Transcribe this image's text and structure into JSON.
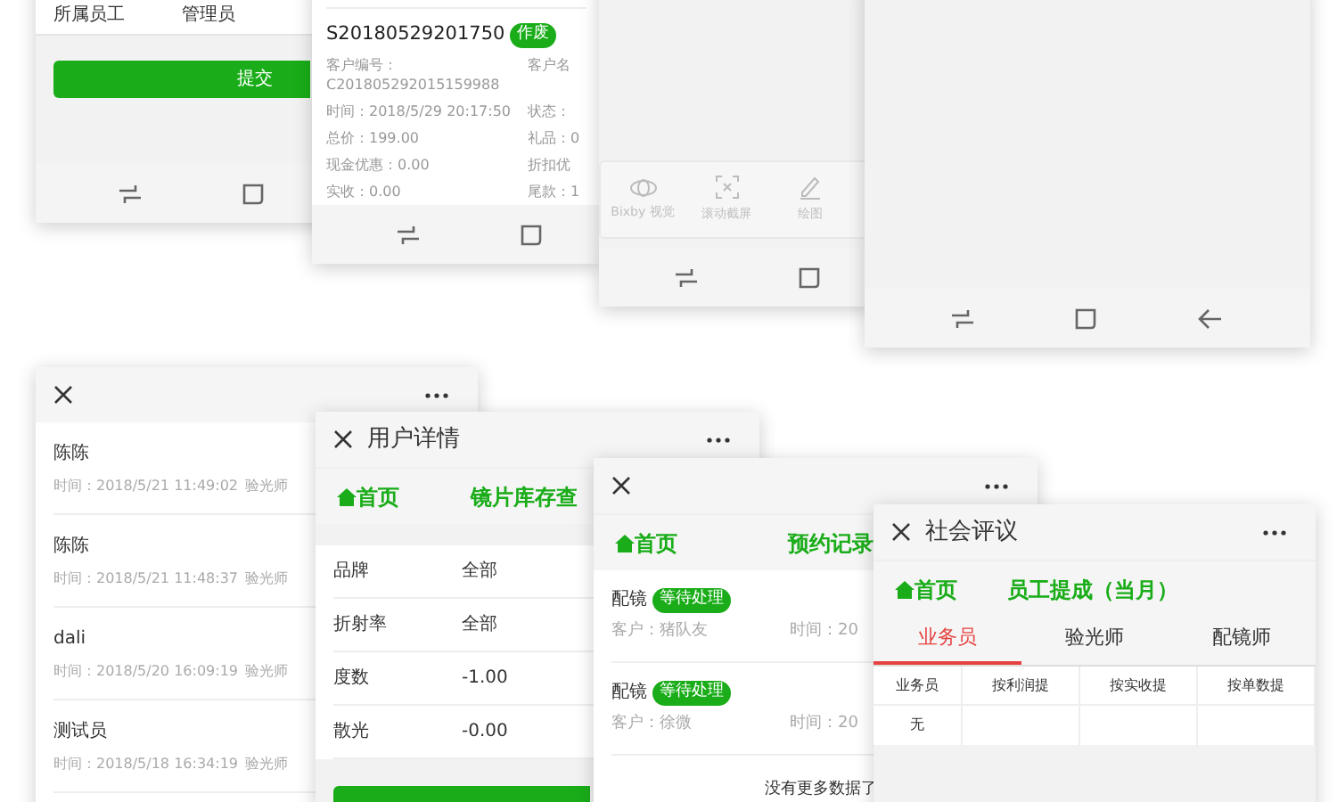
{
  "screens": [
    {
      "kind": "form",
      "rows": [
        {
          "label": "所属员工",
          "value": "管理员"
        }
      ],
      "button": "提交"
    },
    {
      "kind": "order",
      "order_no": "S20180529201750",
      "badge": "作废",
      "fields": [
        {
          "left": "客户编号：C201805292015159988",
          "right": "客户名"
        },
        {
          "left": "时间：2018/5/29 20:17:50",
          "right": "状态："
        },
        {
          "left": "总价：199.00",
          "right": "礼品：0"
        },
        {
          "left": "现金优惠：0.00",
          "right": "折扣优"
        },
        {
          "left": "实收：0.00",
          "right": "尾款：1"
        }
      ]
    },
    {
      "kind": "capture",
      "tools": [
        "Bixby 视觉",
        "滚动截屏",
        "绘图"
      ]
    },
    {
      "kind": "blank"
    },
    {
      "kind": "list",
      "items": [
        {
          "name": "陈陈",
          "time": "时间：2018/5/21 11:49:02",
          "extra": "验光师"
        },
        {
          "name": "陈陈",
          "time": "时间：2018/5/21 11:48:37",
          "extra": "验光师"
        },
        {
          "name": "dali",
          "time": "时间：2018/5/20 16:09:19",
          "extra": "验光师"
        },
        {
          "name": "测试员",
          "time": "时间：2018/5/18 16:34:19",
          "extra": "验光师"
        }
      ]
    },
    {
      "kind": "detail",
      "title": "用户详情",
      "home": "首页",
      "heading": "镜片库存查",
      "rows": [
        {
          "label": "品牌",
          "value": "全部"
        },
        {
          "label": "折射率",
          "value": "全部"
        },
        {
          "label": "度数",
          "value": "-1.00"
        },
        {
          "label": "散光",
          "value": "-0.00"
        }
      ]
    },
    {
      "kind": "records",
      "home": "首页",
      "heading": "预约记录",
      "items": [
        {
          "type": "配镜",
          "status": "等待处理",
          "customer": "客户：猪队友",
          "time": "时间：20"
        },
        {
          "type": "配镜",
          "status": "等待处理",
          "customer": "客户：徐微",
          "time": "时间：20"
        }
      ],
      "footer": "没有更多数据了"
    },
    {
      "kind": "table",
      "title": "社会评议",
      "home": "首页",
      "heading": "员工提成（当月）",
      "tabs": [
        {
          "label": "业务员",
          "selected": true
        },
        {
          "label": "验光师",
          "selected": false
        },
        {
          "label": "配镜师",
          "selected": false
        }
      ],
      "columns": [
        "业务员",
        "按利润提",
        "按实收提",
        "按单数提"
      ],
      "rows": [
        [
          "无"
        ]
      ]
    }
  ]
}
